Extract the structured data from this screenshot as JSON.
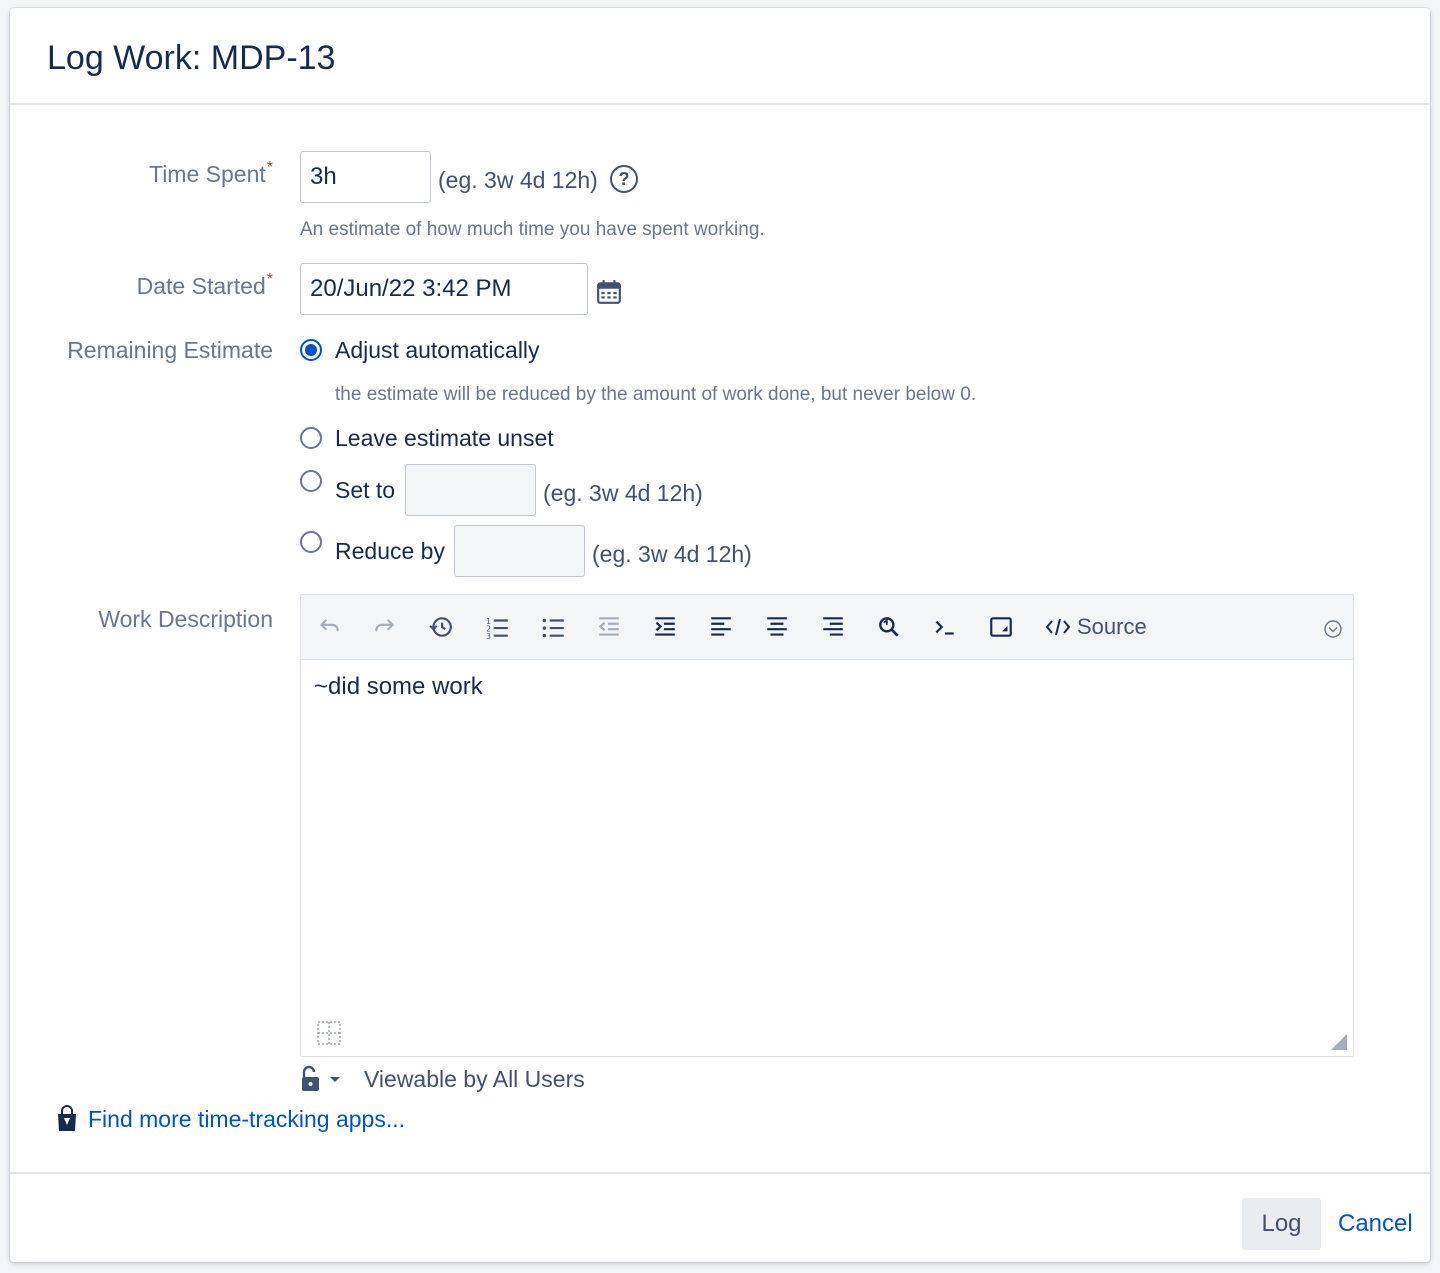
{
  "dialog": {
    "title": "Log Work: MDP-13"
  },
  "time_spent": {
    "label": "Time Spent",
    "required_mark": "*",
    "value": "3h",
    "format_hint": "(eg. 3w 4d 12h)",
    "description": "An estimate of how much time you have spent working."
  },
  "date_started": {
    "label": "Date Started",
    "required_mark": "*",
    "value": "20/Jun/22 3:42 PM"
  },
  "remaining_estimate": {
    "label": "Remaining Estimate",
    "options": [
      {
        "label": "Adjust automatically",
        "checked": true
      },
      {
        "label": "Leave estimate unset",
        "checked": false
      },
      {
        "label": "Set to",
        "checked": false
      },
      {
        "label": "Reduce by",
        "checked": false
      }
    ],
    "adjust_description": "the estimate will be reduced by the amount of work done, but never below 0.",
    "set_to_value": "",
    "set_to_hint": "(eg. 3w 4d 12h)",
    "reduce_by_value": "",
    "reduce_by_hint": "(eg. 3w 4d 12h)"
  },
  "work_description": {
    "label": "Work Description",
    "toolbar": {
      "source_label": "Source",
      "icons": [
        "undo-icon",
        "redo-icon",
        "history-icon",
        "numbered-list-icon",
        "bullet-list-icon",
        "outdent-icon",
        "indent-icon",
        "align-left-icon",
        "align-center-icon",
        "align-right-icon",
        "find-replace-icon",
        "code-icon",
        "preview-icon",
        "source-code-icon",
        "more-options-icon"
      ]
    },
    "text": "~did some work"
  },
  "visibility": {
    "text": "Viewable by All Users"
  },
  "marketplace": {
    "link_text": "Find more time-tracking apps..."
  },
  "footer": {
    "log_label": "Log",
    "cancel_label": "Cancel"
  },
  "colors": {
    "primary": "#0052cc",
    "text": "#172b4d",
    "label": "#6b778c",
    "required": "#de350b",
    "toolbar_bg": "#f4f5f7"
  }
}
